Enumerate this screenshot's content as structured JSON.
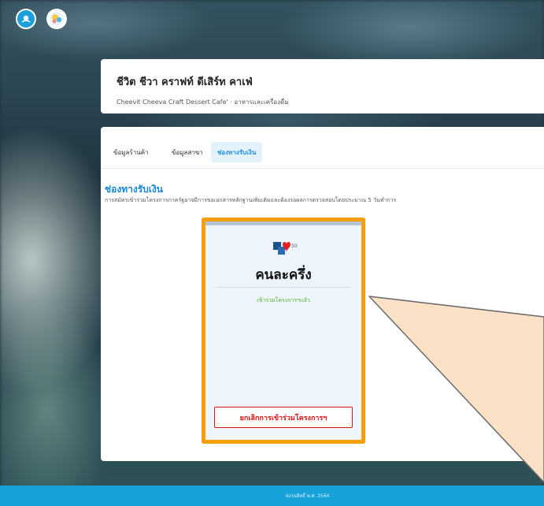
{
  "header": {
    "logos": [
      "bank-logo-icon",
      "program-mascot-icon"
    ]
  },
  "shop": {
    "name": "ชีวิต ชีวา คราฟท์ ดีเสิร์ท คาเฟ่",
    "subtitle": "Cheevit Cheeva Craft Dessert Cafe' · อาหารและเครื่องดื่ม"
  },
  "tabs": [
    {
      "label": "ข้อมูลร้านค้า"
    },
    {
      "label": "ข้อมูลสาขา"
    },
    {
      "label": "ช่องทางรับเงิน",
      "active": true
    }
  ],
  "section": {
    "title": "ช่องทางรับเงิน",
    "description": "การสมัครเข้าร่วมโครงการภาครัฐอาจมีการขอเอกสารหลักฐานเพิ่มเติมและต้องรอผลการตรวจสอบโดยประมาณ 5 วันทำการ"
  },
  "program": {
    "logo_text": "50",
    "name": "คนละครึ่ง",
    "status": "เข้าร่วมโครงการฯแล้ว",
    "cancel_label": "ยกเลิกการเข้าร่วมโครงการฯ"
  },
  "footer": {
    "copyright": "สงวนสิทธิ์ พ.ศ. 2564"
  },
  "colors": {
    "accent": "#1a86cf",
    "highlight": "#f59e0b",
    "success": "#4caf25",
    "danger": "#dd1111",
    "footer": "#17a3d9"
  }
}
